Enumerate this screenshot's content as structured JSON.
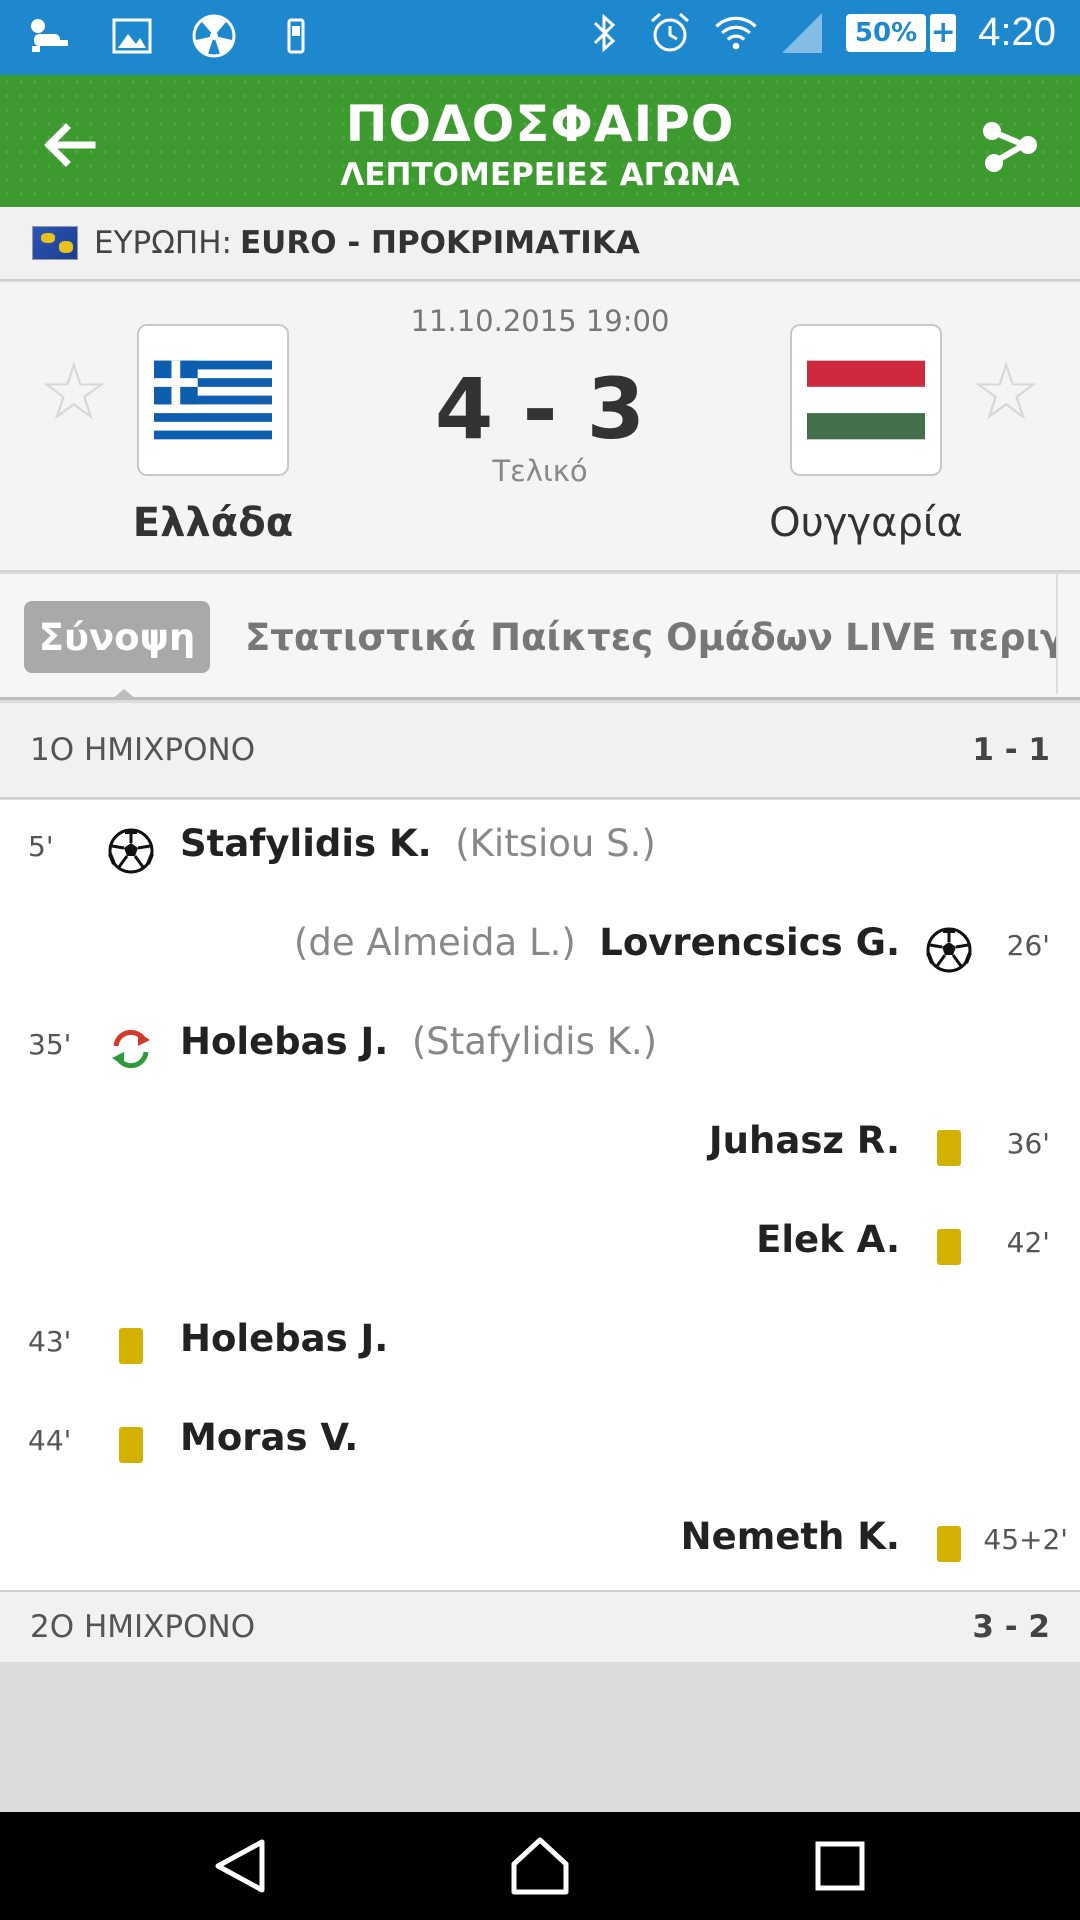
{
  "status_bar": {
    "battery": "50%",
    "battery_plus": "+",
    "time": "4:20",
    "icons": [
      "baby-icon",
      "image-icon",
      "radiation-icon",
      "device-icon",
      "bluetooth-icon",
      "alarm-icon",
      "wifi-icon",
      "signal-icon"
    ]
  },
  "app_bar": {
    "title": "ΠΟΔΟΣΦΑΙΡΟ",
    "subtitle": "ΛΕΠΤΟΜΕΡΕΙΕΣ ΑΓΩΝΑ"
  },
  "competition": {
    "region": "ΕΥΡΩΠΗ:",
    "name": "EURO - ΠΡΟΚΡΙΜΑΤΙΚΑ"
  },
  "match": {
    "date": "11.10.2015 19:00",
    "score": "4 - 3",
    "status": "Τελικό",
    "home_team": "Ελλάδα",
    "away_team": "Ουγγαρία"
  },
  "tabs": [
    {
      "label": "Σύνοψη",
      "active": true
    },
    {
      "label": "Στατιστικά"
    },
    {
      "label": "Παίκτες Ομάδων"
    },
    {
      "label": "LIVE περιγρ"
    }
  ],
  "first_half": {
    "label": "1Ο ΗΜΙΧΡΟΝΟ",
    "score": "1 - 1",
    "events": [
      {
        "side": "home",
        "minute": "5'",
        "type": "goal",
        "player": "Stafylidis K.",
        "assist": "(Kitsiou S.)"
      },
      {
        "side": "away",
        "minute": "26'",
        "type": "goal",
        "player": "Lovrencsics G.",
        "assist": "(de Almeida L.)"
      },
      {
        "side": "home",
        "minute": "35'",
        "type": "substitution",
        "player": "Holebas J.",
        "assist": "(Stafylidis K.)"
      },
      {
        "side": "away",
        "minute": "36'",
        "type": "yellow-card",
        "player": "Juhasz R.",
        "assist": ""
      },
      {
        "side": "away",
        "minute": "42'",
        "type": "yellow-card",
        "player": "Elek A.",
        "assist": ""
      },
      {
        "side": "home",
        "minute": "43'",
        "type": "yellow-card",
        "player": "Holebas J.",
        "assist": ""
      },
      {
        "side": "home",
        "minute": "44'",
        "type": "yellow-card",
        "player": "Moras V.",
        "assist": ""
      },
      {
        "side": "away",
        "minute": "45+2'",
        "type": "yellow-card",
        "player": "Nemeth K.",
        "assist": ""
      }
    ]
  },
  "second_half": {
    "label": "2Ο ΗΜΙΧΡΟΝΟ",
    "score": "3 - 2"
  },
  "colors": {
    "status_bar": "#1e88cf",
    "app_bar": "#3d9a2f",
    "yellow_card": "#d4b000"
  }
}
